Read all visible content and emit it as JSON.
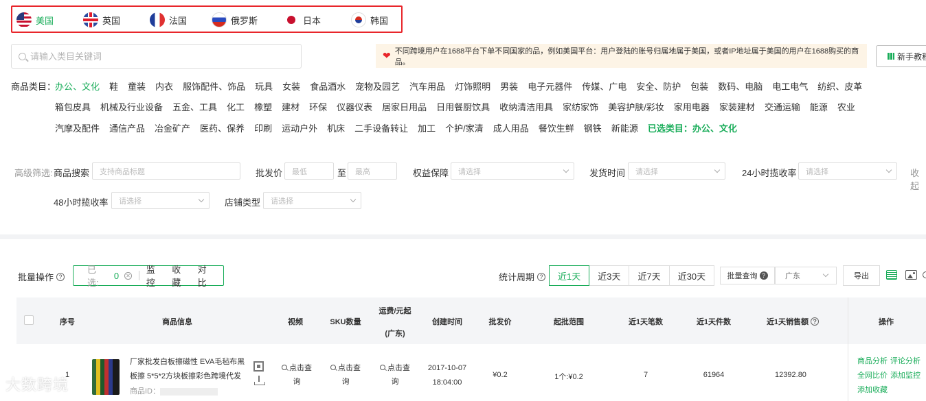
{
  "countries": [
    {
      "label": "美国",
      "flag": "us-flag-icon",
      "active": true
    },
    {
      "label": "英国",
      "flag": "uk-flag-icon",
      "active": false
    },
    {
      "label": "法国",
      "flag": "france-flag-icon",
      "active": false
    },
    {
      "label": "俄罗斯",
      "flag": "russia-flag-icon",
      "active": false
    },
    {
      "label": "日本",
      "flag": "japan-flag-icon",
      "active": false
    },
    {
      "label": "韩国",
      "flag": "korea-flag-icon",
      "active": false
    }
  ],
  "search": {
    "placeholder": "请输入类目关键词"
  },
  "notice": {
    "text": "不同跨境用户在1688平台下单不同国家的品，例如美国平台：用户登陆的账号归属地属于美国，或者IP地址属于美国的用户在1688购买的商品。"
  },
  "tutorial": {
    "label": "新手教程"
  },
  "categories": {
    "label": "商品类目：",
    "row1": [
      "办公、文化",
      "鞋",
      "童装",
      "内衣",
      "服饰配件、饰品",
      "玩具",
      "女装",
      "食品酒水",
      "宠物及园艺",
      "汽车用品",
      "灯饰照明",
      "男装",
      "电子元器件",
      "传媒、广电",
      "安全、防护",
      "包装",
      "数码、电脑",
      "电工电气",
      "纺织、皮革"
    ],
    "row2": [
      "箱包皮具",
      "机械及行业设备",
      "五金、工具",
      "化工",
      "橡塑",
      "建材",
      "环保",
      "仪器仪表",
      "居家日用品",
      "日用餐厨饮具",
      "收纳清洁用具",
      "家纺家饰",
      "美容护肤/彩妆",
      "家用电器",
      "家装建材",
      "交通运输",
      "能源",
      "农业"
    ],
    "row3": [
      "汽摩及配件",
      "通信产品",
      "冶金矿产",
      "医药、保养",
      "印刷",
      "运动户外",
      "机床",
      "二手设备转让",
      "加工",
      "个护/家清",
      "成人用品",
      "餐饮生鲜",
      "钢铁",
      "新能源"
    ],
    "selected": "已选类目：办公、文化"
  },
  "filters": {
    "advanced_label": "高级筛选:",
    "product_search_label": "商品搜索",
    "product_search_placeholder": "支持商品标题",
    "price_label": "批发价",
    "price_min_placeholder": "最低",
    "price_to": "至",
    "price_max_placeholder": "最高",
    "rights_label": "权益保障",
    "ship_time_label": "发货时间",
    "collect24_label": "24小时揽收率",
    "collect_cut": "收起",
    "collect48_label": "48小时揽收率",
    "shop_type_label": "店铺类型",
    "select_placeholder": "请选择"
  },
  "batch": {
    "label": "批量操作",
    "selected_label": "已选:",
    "selected_count": "0",
    "actions": [
      "监控",
      "收藏",
      "对比"
    ]
  },
  "period": {
    "label": "统计周期",
    "tabs": [
      {
        "label": "近1天",
        "active": true
      },
      {
        "label": "近3天",
        "active": false
      },
      {
        "label": "近7天",
        "active": false
      },
      {
        "label": "近30天",
        "active": false
      }
    ]
  },
  "toolbar": {
    "batch_query": "批量查询",
    "region": "广东",
    "export": "导出"
  },
  "table": {
    "headers": {
      "index": "序号",
      "product": "商品信息",
      "video": "视频",
      "sku": "SKU数量",
      "shipping": "运费/元起",
      "shipping_region": "(广东)",
      "created": "创建时间",
      "price": "批发价",
      "batch_range": "起批范围",
      "orders_1d": "近1天笔数",
      "pieces_1d": "近1天件数",
      "sales_1d": "近1天销售额",
      "operation": "操作"
    },
    "rows": [
      {
        "index": "1",
        "title": "厂家批发白板擦磁性 EVA毛毡布黑板擦 5*5*2方块板擦彩色跨境代发",
        "id_label": "商品ID：",
        "video": "点击查询",
        "sku": "点击查询",
        "shipping": "点击查询",
        "created_date": "2017-10-07",
        "created_time": "18:04:00",
        "price": "¥0.2",
        "batch_range": "1个:¥0.2",
        "orders": "7",
        "pieces": "61964",
        "sales": "12392.80",
        "ops": [
          "商品分析",
          "评论分析",
          "全网比价",
          "添加监控",
          "添加收藏"
        ]
      }
    ]
  },
  "watermark": "大数跨境"
}
